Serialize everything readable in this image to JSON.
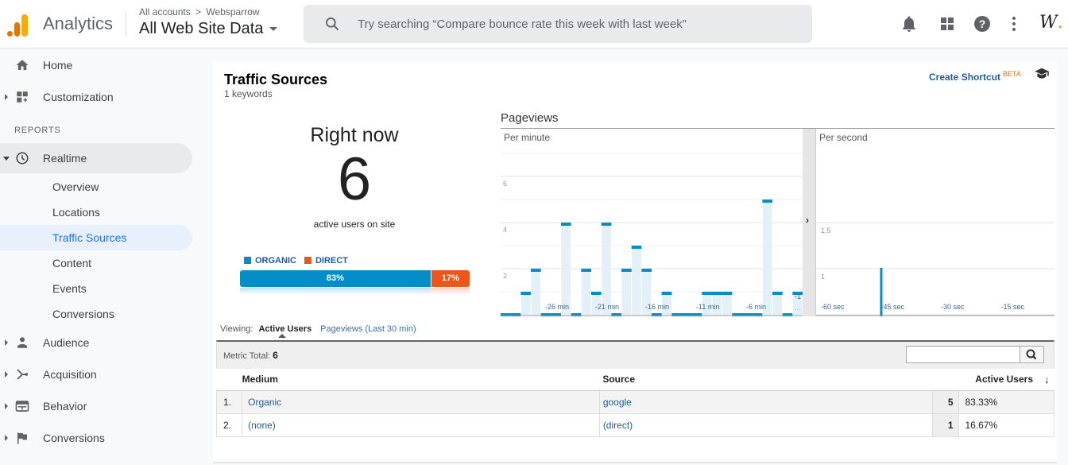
{
  "header": {
    "app_name": "Analytics",
    "breadcrumb": [
      "All accounts",
      "Websparrow"
    ],
    "breadcrumb_separator": ">",
    "property": "All Web Site Data",
    "search_placeholder": "Try searching “Compare bounce rate this week with last week”",
    "icons": [
      "notifications-icon",
      "apps-grid-icon",
      "help-icon",
      "more-vert-icon"
    ],
    "avatar_text": "W",
    "avatar_dot": "."
  },
  "sidebar": {
    "top_items": [
      {
        "label": "Home",
        "icon": "home-icon"
      },
      {
        "label": "Customization",
        "icon": "dashboard-add-icon"
      }
    ],
    "section_label": "REPORTS",
    "realtime": {
      "label": "Realtime",
      "icon": "clock-icon",
      "children": [
        "Overview",
        "Locations",
        "Traffic Sources",
        "Content",
        "Events",
        "Conversions"
      ],
      "selected": "Traffic Sources"
    },
    "bottom_items": [
      {
        "label": "Audience",
        "icon": "person-icon"
      },
      {
        "label": "Acquisition",
        "icon": "merge-icon"
      },
      {
        "label": "Behavior",
        "icon": "web-icon"
      },
      {
        "label": "Conversions",
        "icon": "flag-icon"
      }
    ]
  },
  "main": {
    "title": "Traffic Sources",
    "subtitle": "1 keywords",
    "shortcut": {
      "label": "Create Shortcut",
      "badge": "BETA"
    },
    "right_now": {
      "label": "Right now",
      "value": "6",
      "caption": "active users on site"
    },
    "split": {
      "segments": [
        {
          "label": "ORGANIC",
          "percent": 83,
          "display": "83%",
          "color": "#058dc7"
        },
        {
          "label": "DIRECT",
          "percent": 17,
          "display": "17%",
          "color": "#ed561b"
        }
      ]
    },
    "pageviews_title": "Pageviews",
    "expand_glyph": "›",
    "viewing": {
      "label": "Viewing:",
      "current": "Active Users",
      "alternate": "Pageviews (Last 30 min)"
    },
    "table": {
      "metric_total_label": "Metric Total:",
      "metric_total": "6",
      "columns": [
        "Medium",
        "Source",
        "Active Users"
      ],
      "sort_glyph": "↓",
      "rows": [
        {
          "index": "1.",
          "medium": "Organic",
          "source": "google",
          "value": "5",
          "percent": "83.33%"
        },
        {
          "index": "2.",
          "medium": "(none)",
          "source": "(direct)",
          "value": "1",
          "percent": "16.67%"
        }
      ]
    }
  },
  "chart_data": [
    {
      "type": "bar",
      "title": "Per minute",
      "xlabel": "",
      "ylabel": "Pageviews",
      "ylim": [
        0,
        8
      ],
      "yticks": [
        2,
        4,
        6
      ],
      "xtick_labels": [
        "-26 min",
        "-21 min",
        "-16 min",
        "-11 min",
        "-6 min",
        "-1 ..."
      ],
      "values": [
        0,
        0,
        1,
        2,
        0,
        0,
        4,
        0,
        2,
        1,
        4,
        0,
        2,
        3,
        2,
        0,
        1,
        0,
        0,
        0,
        1,
        1,
        1,
        0,
        0,
        0,
        5,
        1,
        0,
        1
      ],
      "color": "#058dc7",
      "fill": "#e3f0f7",
      "grid": true
    },
    {
      "type": "bar",
      "title": "Per second",
      "xlabel": "",
      "ylabel": "Pageviews",
      "ylim": [
        0,
        2
      ],
      "yticks": [
        0.5,
        1,
        1.5
      ],
      "xtick_labels": [
        "-60 sec",
        "-45 sec",
        "-30 sec",
        "-15 sec"
      ],
      "x_range": [
        -60,
        0
      ],
      "points": [
        {
          "x": -44,
          "y": 1
        }
      ],
      "color": "#058dc7",
      "grid": true
    }
  ]
}
